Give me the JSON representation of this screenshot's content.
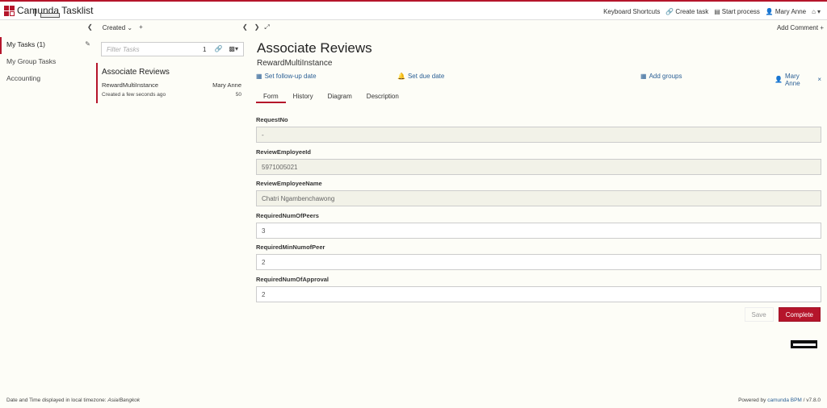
{
  "app": {
    "title": "Camunda Tasklist"
  },
  "topnav": {
    "keyboard_shortcuts": "Keyboard Shortcuts",
    "create_task": "Create task",
    "start_process": "Start process",
    "user": "Mary Anne"
  },
  "sidebar": {
    "items": [
      {
        "label": "My Tasks (1)"
      },
      {
        "label": "My Group Tasks"
      },
      {
        "label": "Accounting"
      }
    ]
  },
  "list": {
    "sort_label": "Created",
    "filter_placeholder": "Filter Tasks",
    "filter_count": "1"
  },
  "task": {
    "name": "Associate Reviews",
    "process": "RewardMultiInstance",
    "assignee": "Mary Anne",
    "created": "Created a few seconds ago",
    "priority": "50"
  },
  "detail": {
    "title": "Associate Reviews",
    "subtitle": "RewardMultiInstance",
    "add_comment": "Add Comment",
    "actions": {
      "followup": "Set follow-up date",
      "due": "Set due date",
      "groups": "Add groups",
      "assignee": "Mary Anne"
    },
    "tabs": [
      {
        "label": "Form"
      },
      {
        "label": "History"
      },
      {
        "label": "Diagram"
      },
      {
        "label": "Description"
      }
    ]
  },
  "form": {
    "fields": [
      {
        "label": "RequestNo",
        "value": "-"
      },
      {
        "label": "ReviewEmployeeId",
        "value": "5971005021"
      },
      {
        "label": "ReviewEmployeeName",
        "value": "Chatri Ngambenchawong"
      },
      {
        "label": "RequiredNumOfPeers",
        "value": "3"
      },
      {
        "label": "RequiredMinNumofPeer",
        "value": "2"
      },
      {
        "label": "RequiredNumOfApproval",
        "value": "2"
      }
    ],
    "save": "Save",
    "complete": "Complete"
  },
  "footer": {
    "tz_prefix": "Date and Time displayed in local timezone:",
    "tz": "Asia/Bangkok",
    "powered": "Powered by",
    "product": "camunda BPM",
    "version": "/ v7.8.0"
  },
  "colors": {
    "accent": "#b5152b",
    "link": "#2a5f95"
  }
}
